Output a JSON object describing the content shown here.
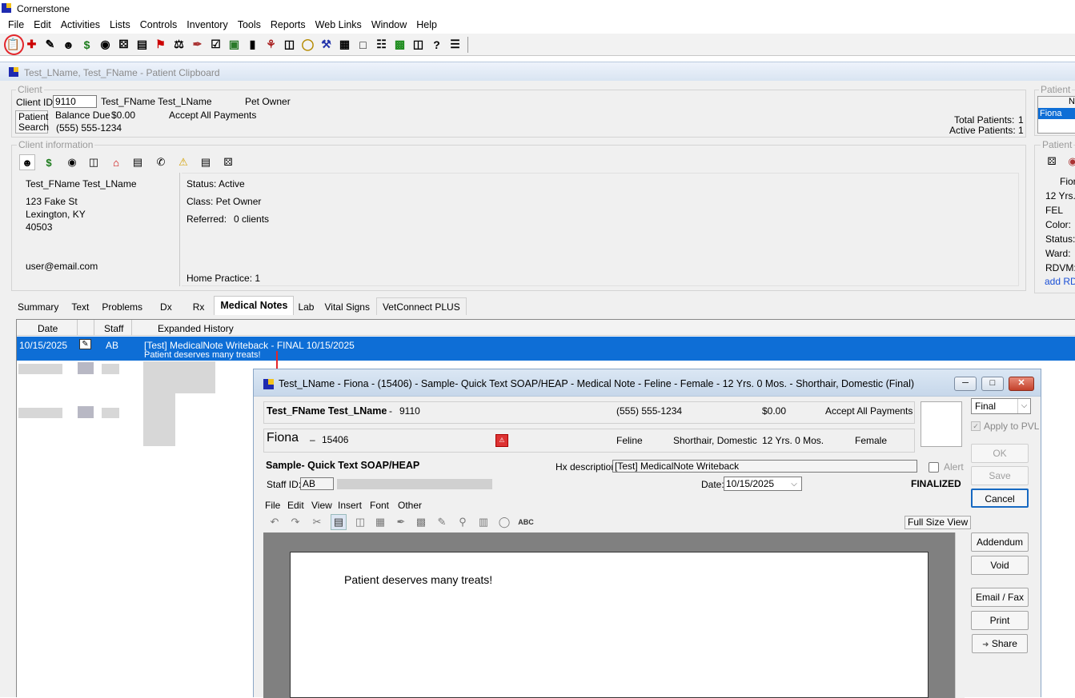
{
  "app": {
    "title": "Cornerstone"
  },
  "menu": [
    "File",
    "Edit",
    "Activities",
    "Lists",
    "Controls",
    "Inventory",
    "Tools",
    "Reports",
    "Web Links",
    "Window",
    "Help"
  ],
  "clipboard": {
    "title": "Test_LName, Test_FName - Patient Clipboard"
  },
  "client": {
    "group_label": "Client",
    "client_id_label": "Client ID:",
    "client_id": "9110",
    "name": "Test_FName Test_LName",
    "owner_type": "Pet Owner",
    "patient_search_line1": "Patient",
    "patient_search_line2": "Search",
    "balance_label": "Balance Due",
    "balance": "$0.00",
    "payments": "Accept All Payments",
    "phone": "(555) 555-1234",
    "total_patients_label": "Total Patients:",
    "total_patients": "1",
    "active_patients_label": "Active Patients:",
    "active_patients": "1"
  },
  "client_info": {
    "group_label": "Client information",
    "name": "Test_FName Test_LName",
    "address1": "123 Fake St",
    "address2": "Lexington, KY",
    "zip": "40503",
    "email": "user@email.com",
    "status": "Status: Active",
    "class": "Class:  Pet Owner",
    "referred_label": "Referred:",
    "referred": "0 clients",
    "home_practice": "Home Practice: 1"
  },
  "patient_panel": {
    "group_label": "Patient",
    "col_header": "N",
    "selected": "Fiona",
    "group2_label": "Patient",
    "name_partial": "Fior",
    "age_partial": "12 Yrs.",
    "species": "FEL",
    "color_label": "Color:",
    "status_label": "Status:",
    "ward_label": "Ward:",
    "rdvm_label": "RDVM:",
    "add_rdvm": "add RDV"
  },
  "tabs": [
    "Summary",
    "Text",
    "Problems",
    "Dx",
    "Rx",
    "Medical Notes",
    "Lab",
    "Vital Signs",
    "VetConnect PLUS"
  ],
  "active_tab": "Medical Notes",
  "history": {
    "headers": {
      "date": "Date",
      "staff": "Staff",
      "expanded": "Expanded History"
    },
    "selected_row": {
      "date": "10/15/2025",
      "staff": "AB",
      "line1": "[Test] MedicalNote Writeback - FINAL 10/15/2025",
      "line2": "Patient deserves many treats!"
    }
  },
  "modal": {
    "title": "Test_LName - Fiona - (15406) - Sample- Quick Text SOAP/HEAP - Medical Note - Feline - Female - 12 Yrs. 0 Mos. - Shorthair, Domestic (Final)",
    "client_name": "Test_FName Test_LName",
    "client_dash": "-",
    "client_id": "9110",
    "phone": "(555) 555-1234",
    "balance": "$0.00",
    "payments": "Accept All Payments",
    "patient_name": "Fiona",
    "patient_dash": "–",
    "patient_id": "15406",
    "species": "Feline",
    "breed": "Shorthair, Domestic",
    "age": "12 Yrs. 0 Mos.",
    "sex": "Female",
    "template_name": "Sample- Quick Text SOAP/HEAP",
    "hx_label": "Hx description:",
    "hx_value": "[Test] MedicalNote Writeback",
    "alert_label": "Alert",
    "staff_label": "Staff ID:",
    "staff_value": "AB",
    "date_label": "Date:",
    "date_value": "10/15/2025",
    "finalized": "FINALIZED",
    "status_select": "Final",
    "apply_pvl": "Apply to PVL",
    "editor_menu": [
      "File",
      "Edit",
      "View",
      "Insert",
      "Font",
      "Other"
    ],
    "full_size_view": "Full Size View",
    "note_text": "Patient deserves many treats!",
    "buttons": {
      "ok": "OK",
      "save": "Save",
      "cancel": "Cancel",
      "addendum": "Addendum",
      "void": "Void",
      "email_fax": "Email / Fax",
      "print": "Print",
      "share": "Share"
    }
  },
  "colors": {
    "selection": "#0e6ed6",
    "highlight_circle": "#e3262b",
    "logo_blue": "#1f2bb0",
    "logo_yellow": "#f3c21c"
  }
}
